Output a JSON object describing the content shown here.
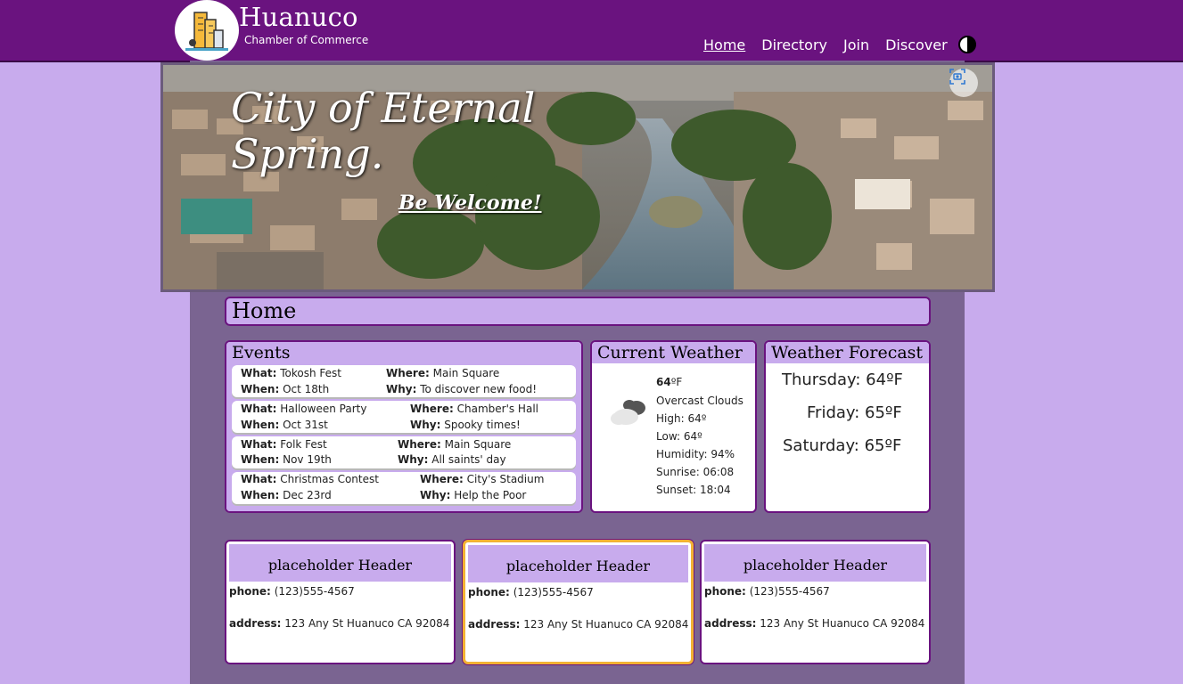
{
  "header": {
    "title": "Huanuco",
    "subtitle": "Chamber of Commerce",
    "nav": [
      {
        "label": "Home",
        "active": true
      },
      {
        "label": "Directory",
        "active": false
      },
      {
        "label": "Join",
        "active": false
      },
      {
        "label": "Discover",
        "active": false
      }
    ],
    "theme_toggle_icon": "contrast-icon"
  },
  "hero": {
    "title": "City of Eternal Spring.",
    "welcome": "Be Welcome!",
    "camera_icon": "camera-search-icon"
  },
  "page_heading": "Home",
  "events": {
    "heading": "Events",
    "items": [
      {
        "what_label": "What:",
        "what": "Tokosh Fest",
        "when_label": "When:",
        "when": "Oct 18th",
        "where_label": "Where:",
        "where": "Main Square",
        "why_label": "Why:",
        "why": "To discover new food!"
      },
      {
        "what_label": "What:",
        "what": "Halloween Party",
        "when_label": "When:",
        "when": "Oct 31st",
        "where_label": "Where:",
        "where": "Chamber's Hall",
        "why_label": "Why:",
        "why": "Spooky times!"
      },
      {
        "what_label": "What:",
        "what": "Folk Fest",
        "when_label": "When:",
        "when": "Nov 19th",
        "where_label": "Where:",
        "where": "Main Square",
        "why_label": "Why:",
        "why": "All saints' day"
      },
      {
        "what_label": "What:",
        "what": "Christmas Contest",
        "when_label": "When:",
        "when": "Dec 23rd",
        "where_label": "Where:",
        "where": "City's Stadium",
        "why_label": "Why:",
        "why": "Help the Poor"
      }
    ]
  },
  "weather": {
    "heading": "Current Weather",
    "temp": "64",
    "unit": "ºF",
    "description": "Overcast Clouds",
    "high": "High: 64º",
    "low": "Low: 64º",
    "humidity": "Humidity: 94%",
    "sunrise": "Sunrise: 06:08",
    "sunset": "Sunset: 18:04",
    "icon": "overcast-cloud-icon"
  },
  "forecast": {
    "heading": "Weather Forecast",
    "days": [
      "Thursday: 64ºF",
      "Friday: 65ºF",
      "Saturday: 65ºF"
    ]
  },
  "businesses": [
    {
      "header": "placeholder Header",
      "phone_label": "phone:",
      "phone": "(123)555-4567",
      "address_label": "address:",
      "address": "123 Any St Huanuco CA 92084"
    },
    {
      "header": "placeholder Header",
      "phone_label": "phone:",
      "phone": "(123)555-4567",
      "address_label": "address:",
      "address": "123 Any St Huanuco CA 92084"
    },
    {
      "header": "placeholder Header",
      "phone_label": "phone:",
      "phone": "(123)555-4567",
      "address_label": "address:",
      "address": "123 Any St Huanuco CA 92084"
    }
  ]
}
